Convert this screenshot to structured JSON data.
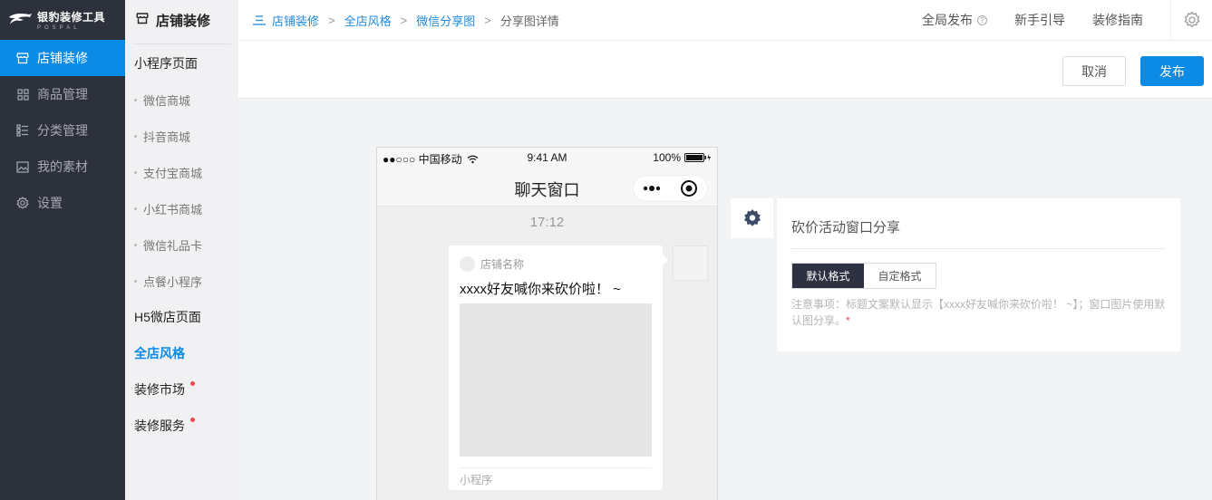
{
  "brand": {
    "title": "银豹装修工具",
    "subtitle": "POSPAL"
  },
  "nav": {
    "items": [
      {
        "label": "店铺装修",
        "icon": "store-icon",
        "active": true
      },
      {
        "label": "商品管理",
        "icon": "grid-icon",
        "active": false
      },
      {
        "label": "分类管理",
        "icon": "list-icon",
        "active": false
      },
      {
        "label": "我的素材",
        "icon": "image-icon",
        "active": false
      },
      {
        "label": "设置",
        "icon": "gear-icon",
        "active": false
      }
    ]
  },
  "subnav": {
    "title": "店铺装修",
    "group_miniprogram": "小程序页面",
    "children": [
      "微信商城",
      "抖音商城",
      "支付宝商城",
      "小红书商城",
      "微信礼品卡",
      "点餐小程序"
    ],
    "group_h5": "H5微店页面",
    "group_style": "全店风格",
    "group_market": "装修市场",
    "group_service": "装修服务"
  },
  "breadcrumb": {
    "items": [
      "店铺装修",
      "全店风格",
      "微信分享图"
    ],
    "current": "分享图详情",
    "separator": ">"
  },
  "header": {
    "publish_all": "全局发布",
    "help_mark": "?",
    "guide": "新手引导",
    "manual": "装修指南"
  },
  "actions": {
    "cancel": "取消",
    "publish": "发布"
  },
  "phone": {
    "carrier": "●●○○○ 中国移动",
    "time": "9:41 AM",
    "battery": "100%",
    "chat_title": "聊天窗口",
    "message_time": "17:12",
    "card": {
      "shop_name": "店铺名称",
      "title": "xxxx好友喊你来砍价啦！ ~",
      "footer": "小程序"
    }
  },
  "panel": {
    "title": "砍价活动窗口分享",
    "tabs": [
      {
        "label": "默认格式",
        "active": true
      },
      {
        "label": "自定格式",
        "active": false
      }
    ],
    "note": "注意事项：标题文案默认显示【xxxx好友喊你来砍价啦！ ~】；窗口图片使用默认图分享。",
    "required_mark": "*"
  },
  "colors": {
    "sidebar_bg": "#2d313b",
    "accent": "#0b8ae6",
    "badge_red": "#f24b4b"
  }
}
